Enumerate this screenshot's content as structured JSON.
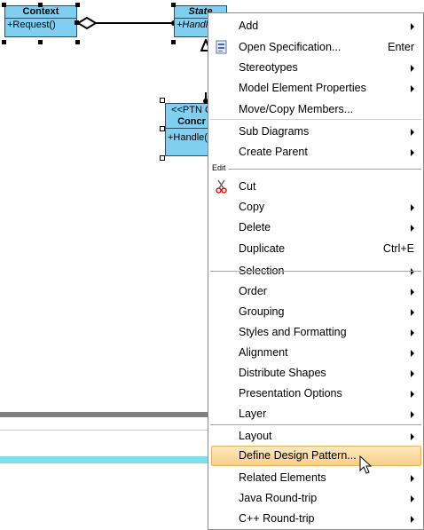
{
  "diagram": {
    "context_class": {
      "name": "Context",
      "operation": "+Request()"
    },
    "state_class": {
      "name": "State",
      "operation": "+Handle"
    },
    "concrete_class": {
      "stereotype": "<<PTN C",
      "name": "Concr",
      "operation": "+Handle()"
    }
  },
  "context_menu": {
    "items": [
      {
        "label": "Add",
        "submenu": true
      },
      {
        "label": "Open Specification...",
        "shortcut": "Enter",
        "icon": "specification-icon"
      },
      {
        "label": "Stereotypes",
        "submenu": true
      },
      {
        "label": "Model Element Properties",
        "submenu": true
      },
      {
        "label": "Move/Copy Members..."
      },
      {
        "label": "Sub Diagrams",
        "submenu": true
      },
      {
        "label": "Create Parent",
        "submenu": true
      },
      {
        "label": "Cut",
        "icon": "scissors-icon"
      },
      {
        "label": "Copy",
        "submenu": true
      },
      {
        "label": "Delete",
        "submenu": true
      },
      {
        "label": "Duplicate",
        "shortcut": "Ctrl+E"
      },
      {
        "label": "Selection",
        "submenu": true
      },
      {
        "label": "Order",
        "submenu": true
      },
      {
        "label": "Grouping",
        "submenu": true
      },
      {
        "label": "Styles and Formatting",
        "submenu": true
      },
      {
        "label": "Alignment",
        "submenu": true
      },
      {
        "label": "Distribute Shapes",
        "submenu": true
      },
      {
        "label": "Presentation Options",
        "submenu": true
      },
      {
        "label": "Layer",
        "submenu": true
      },
      {
        "label": "Layout",
        "submenu": true
      },
      {
        "label": "Define Design Pattern...",
        "highlighted": true
      },
      {
        "label": "Related Elements",
        "submenu": true
      },
      {
        "label": "Java Round-trip",
        "submenu": true
      },
      {
        "label": "C++ Round-trip",
        "submenu": true
      }
    ],
    "section_label": "Edit"
  },
  "colors": {
    "class_fill": "#7fd0f0",
    "highlight": "#f8cf86",
    "cyan_bar": "#7fe0ec"
  }
}
